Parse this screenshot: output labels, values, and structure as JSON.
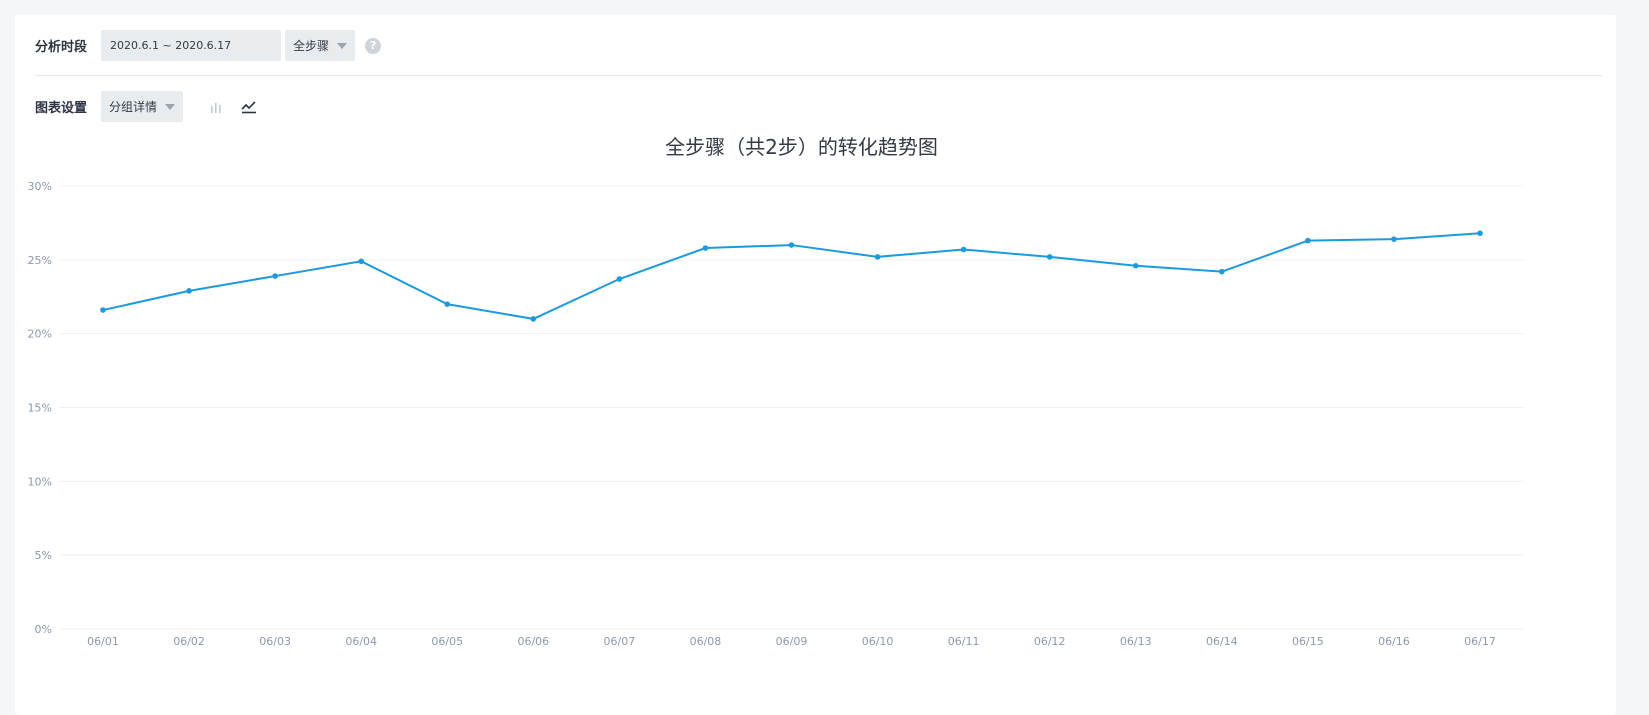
{
  "toolbar": {
    "period_label": "分析时段",
    "date_range": "2020.6.1 ~ 2020.6.17",
    "step_select": "全步骤",
    "help": "?",
    "chart_settings_label": "图表设置",
    "group_select": "分组详情",
    "chart_types": [
      "bar",
      "line"
    ],
    "active_chart_type": "line"
  },
  "colors": {
    "series": "#1a9ae0",
    "grid": "#edf0f3",
    "axis_text": "#8c99ad"
  },
  "chart_data": {
    "type": "line",
    "title": "全步骤（共2步）的转化趋势图",
    "categories": [
      "06/01",
      "06/02",
      "06/03",
      "06/04",
      "06/05",
      "06/06",
      "06/07",
      "06/08",
      "06/09",
      "06/10",
      "06/11",
      "06/12",
      "06/13",
      "06/14",
      "06/15",
      "06/16",
      "06/17"
    ],
    "series": [
      {
        "values": [
          21.6,
          22.9,
          23.9,
          24.9,
          22.0,
          21.0,
          23.7,
          25.8,
          26.0,
          25.2,
          25.7,
          25.2,
          24.6,
          24.2,
          26.3,
          26.4,
          26.8
        ]
      }
    ],
    "y_ticks": [
      "0%",
      "5%",
      "10%",
      "15%",
      "20%",
      "25%",
      "30%"
    ],
    "ylim": [
      0,
      30
    ],
    "grid": true
  }
}
